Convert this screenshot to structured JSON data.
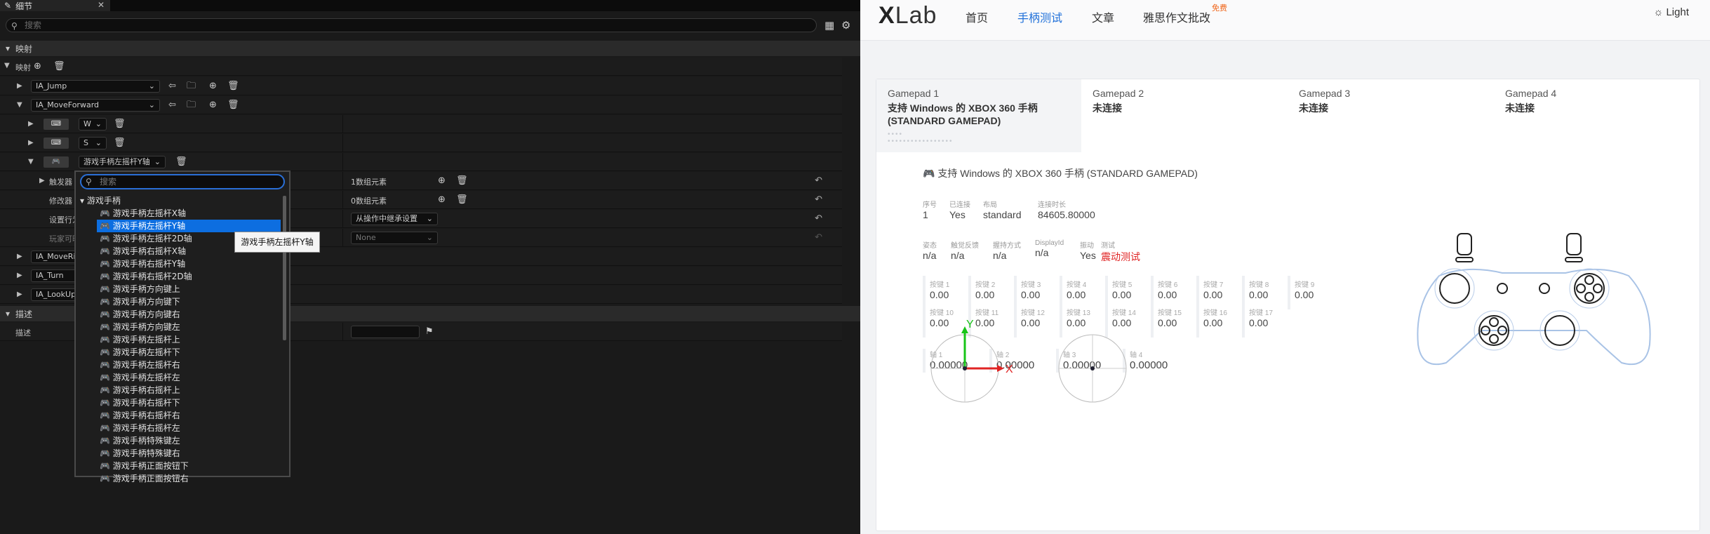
{
  "editor": {
    "tab_title": "细节",
    "search_placeholder": "搜索",
    "section_mapping": "映射",
    "mapping_label": "映射",
    "actions": [
      {
        "name": "IA_Jump"
      },
      {
        "name": "IA_MoveForward"
      }
    ],
    "keys": [
      {
        "label": "W"
      },
      {
        "label": "S"
      }
    ],
    "gamepad_key": "游戏手柄左摇杆Y轴",
    "triggers_label": "触发器",
    "triggers_value": "1数组元素",
    "modifiers_label": "修改器",
    "modifiers_value": "0数组元素",
    "settings_label": "设置行为",
    "settings_value": "从操作中继承设置",
    "player_label": "玩家可映射",
    "player_value": "None",
    "lower_actions": [
      "IA_MoveRight",
      "IA_Turn",
      "IA_LookUp"
    ],
    "section_description": "描述",
    "description_label": "描述",
    "popup": {
      "search_placeholder": "搜索",
      "category": "游戏手柄",
      "items": [
        "游戏手柄左摇杆X轴",
        "游戏手柄左摇杆Y轴",
        "游戏手柄左摇杆2D轴",
        "游戏手柄右摇杆X轴",
        "游戏手柄右摇杆Y轴",
        "游戏手柄右摇杆2D轴",
        "游戏手柄方向键上",
        "游戏手柄方向键下",
        "游戏手柄方向键右",
        "游戏手柄方向键左",
        "游戏手柄左摇杆上",
        "游戏手柄左摇杆下",
        "游戏手柄左摇杆右",
        "游戏手柄左摇杆左",
        "游戏手柄右摇杆上",
        "游戏手柄右摇杆下",
        "游戏手柄右摇杆右",
        "游戏手柄右摇杆左",
        "游戏手柄特殊键左",
        "游戏手柄特殊键右",
        "游戏手柄正面按钮下",
        "游戏手柄正面按钮右"
      ],
      "selected_index": 1
    },
    "tooltip": "游戏手柄左摇杆Y轴"
  },
  "site": {
    "logo_x": "X",
    "logo_lab": "Lab",
    "nav": [
      "首页",
      "手柄测试",
      "文章",
      "雅思作文批改"
    ],
    "nav_active": 1,
    "nav_badge": "免费",
    "theme": "Light",
    "gamepads": [
      {
        "name": "Gamepad 1",
        "status": "支持 Windows 的 XBOX 360 手柄 (STANDARD GAMEPAD)"
      },
      {
        "name": "Gamepad 2",
        "status": "未连接"
      },
      {
        "name": "Gamepad 3",
        "status": "未连接"
      },
      {
        "name": "Gamepad 4",
        "status": "未连接"
      }
    ],
    "device_title": "支持 Windows 的 XBOX 360 手柄 (STANDARD GAMEPAD)",
    "info1": [
      {
        "label": "序号",
        "value": "1"
      },
      {
        "label": "已连接",
        "value": "Yes"
      },
      {
        "label": "布局",
        "value": "standard"
      },
      {
        "label": "连接时长",
        "value": "84605.80000"
      }
    ],
    "info2": [
      {
        "label": "姿态",
        "value": "n/a"
      },
      {
        "label": "触觉反馈",
        "value": "n/a"
      },
      {
        "label": "握持方式",
        "value": "n/a"
      },
      {
        "label": "DisplayId",
        "value": "n/a"
      },
      {
        "label": "振动",
        "value": "Yes"
      },
      {
        "label": "测试",
        "value": "震动测试"
      }
    ],
    "buttons": [
      {
        "label": "按键 1",
        "value": "0.00"
      },
      {
        "label": "按键 2",
        "value": "0.00"
      },
      {
        "label": "按键 3",
        "value": "0.00"
      },
      {
        "label": "按键 4",
        "value": "0.00"
      },
      {
        "label": "按键 5",
        "value": "0.00"
      },
      {
        "label": "按键 6",
        "value": "0.00"
      },
      {
        "label": "按键 7",
        "value": "0.00"
      },
      {
        "label": "按键 8",
        "value": "0.00"
      },
      {
        "label": "按键 9",
        "value": "0.00"
      },
      {
        "label": "按键 10",
        "value": "0.00"
      },
      {
        "label": "按键 11",
        "value": "0.00"
      },
      {
        "label": "按键 12",
        "value": "0.00"
      },
      {
        "label": "按键 13",
        "value": "0.00"
      },
      {
        "label": "按键 14",
        "value": "0.00"
      },
      {
        "label": "按键 15",
        "value": "0.00"
      },
      {
        "label": "按键 16",
        "value": "0.00"
      },
      {
        "label": "按键 17",
        "value": "0.00"
      }
    ],
    "axes": [
      {
        "label": "轴 1",
        "value": "0.00000"
      },
      {
        "label": "轴 2",
        "value": "0.00000"
      },
      {
        "label": "轴 3",
        "value": "0.00000"
      },
      {
        "label": "轴 4",
        "value": "0.00000"
      }
    ],
    "stick_y": "Y",
    "stick_x": "X",
    "colors": {
      "accent": "#1e6fd9",
      "danger": "#e02424",
      "badge": "#f06418",
      "selected": "#0d6ee0"
    }
  }
}
